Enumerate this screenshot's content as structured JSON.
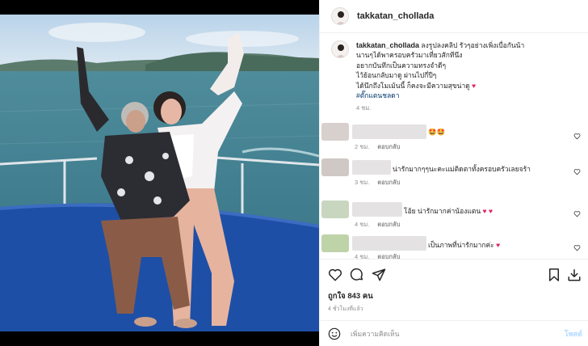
{
  "post": {
    "username": "takkatan_chollada",
    "caption_lines": [
      "ลงรูปลงคลิป รัวๆอย่างเพิ่งเบื่อกันน้า",
      "นานๆได้พาครอบครัวมาเที่ยวสักทีนึง",
      "อยากบันทึกเป็นความทรงจำดีๆ",
      "ไว้ย้อนกลับมาดู ผ่านไปกี่ปีๆ",
      "ได้นึกถึงโมเม้นนี้ ก็คงจะมีความสุขน่าดู"
    ],
    "hashtag": "#ตั๊กแตนชลดา",
    "caption_time": "4 ชม.",
    "likes": "ถูกใจ 843 คน",
    "time_ago": "4 ชั่วโมงที่แล้ว"
  },
  "comments": [
    {
      "text": "🤩🤩",
      "time": "2 ชม.",
      "reply": "ตอบกลับ"
    },
    {
      "text": "น่ารักมากๆๆนะคะแม่ติดตาทั้งครอบครัวเลยจร้า",
      "time": "3 ชม.",
      "reply": "ตอบกลับ"
    },
    {
      "text": "โอ้ย น่ารักมากค่าน้องแตน",
      "time": "4 ชม.",
      "reply": "ตอบกลับ"
    },
    {
      "text": "เป็นภาพที่น่ารักมากค่ะ",
      "time": "4 ชม.",
      "reply": "ตอบกลับ"
    }
  ],
  "composer": {
    "placeholder": "เพิ่มความคิดเห็น",
    "post_label": "โพสต์"
  },
  "icons": {
    "like": "heart-icon",
    "comment": "comment-icon",
    "share": "share-icon",
    "save": "bookmark-icon",
    "download": "download-icon",
    "emoji": "emoji-icon"
  },
  "colors": {
    "accent_blue": "#0095f6",
    "post_button_disabled": "#b3dbff",
    "heart_red": "#e0245e",
    "text": "#262626",
    "secondary": "#8e8e8e",
    "hashtag": "#00376b"
  }
}
